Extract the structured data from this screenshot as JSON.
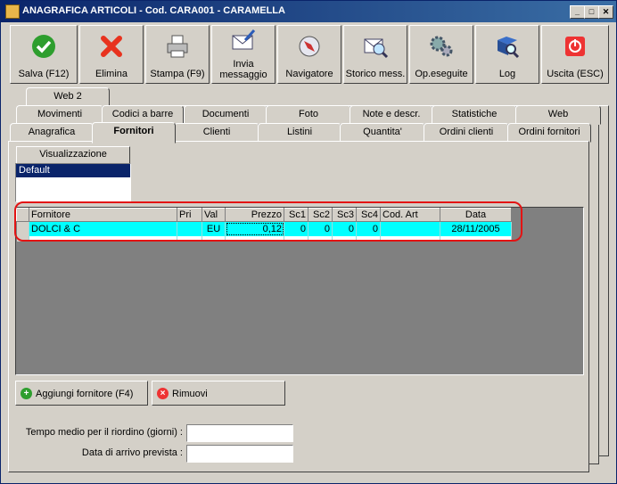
{
  "window": {
    "title": "ANAGRAFICA ARTICOLI - Cod. CARA001 - CARAMELLA"
  },
  "toolbar": [
    {
      "label": "Salva (F12)",
      "icon": "check-icon"
    },
    {
      "label": "Elimina",
      "icon": "x-icon"
    },
    {
      "label": "Stampa (F9)",
      "icon": "printer-icon"
    },
    {
      "label": "Invia messaggio",
      "icon": "envelope-pen-icon"
    },
    {
      "label": "Navigatore",
      "icon": "compass-icon"
    },
    {
      "label": "Storico mess.",
      "icon": "envelope-search-icon"
    },
    {
      "label": "Op.eseguite",
      "icon": "gears-icon"
    },
    {
      "label": "Log",
      "icon": "log-search-icon"
    },
    {
      "label": "Uscita (ESC)",
      "icon": "power-icon"
    }
  ],
  "tabs_row1": [
    "Web 2"
  ],
  "tabs_row2": [
    "Movimenti",
    "Codici a barre",
    "Documenti",
    "Foto",
    "Note e descr.",
    "Statistiche",
    "Web"
  ],
  "tabs_row3": [
    "Anagrafica",
    "Fornitori",
    "Clienti",
    "Listini",
    "Quantita'",
    "Ordini clienti",
    "Ordini fornitori"
  ],
  "active_tab": "Fornitori",
  "visualizzazione": {
    "header": "Visualizzazione",
    "items": [
      "Default"
    ]
  },
  "grid": {
    "columns": [
      "Fornitore",
      "Pri",
      "Val",
      "Prezzo",
      "Sc1",
      "Sc2",
      "Sc3",
      "Sc4",
      "Cod. Art",
      "Data"
    ],
    "rows": [
      [
        "DOLCI & C",
        "",
        "EU",
        "0,12",
        "0",
        "0",
        "0",
        "0",
        "",
        "28/11/2005"
      ]
    ]
  },
  "buttons": {
    "add": "Aggiungi fornitore (F4)",
    "remove": "Rimuovi"
  },
  "fields": {
    "tempo_label": "Tempo medio per il riordino (giorni) :",
    "tempo_value": "",
    "data_label": "Data di arrivo prevista :",
    "data_value": ""
  },
  "colors": {
    "selection": "#00ffff",
    "highlight": "#e31313",
    "titlebar": "#0a246a"
  }
}
